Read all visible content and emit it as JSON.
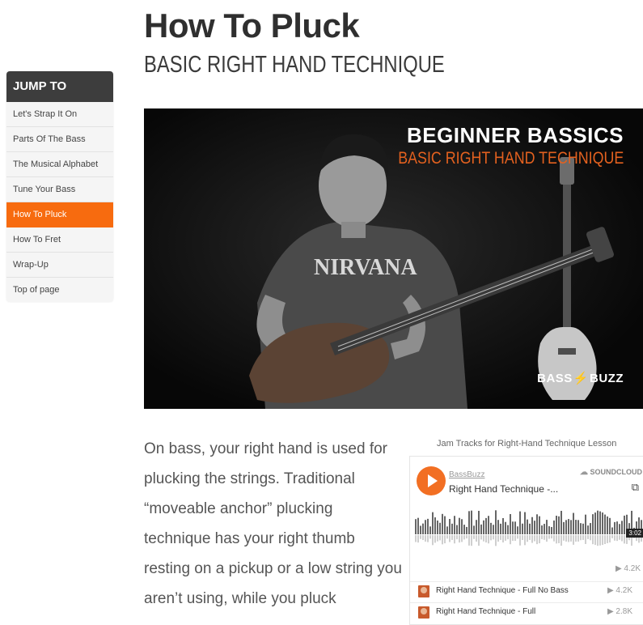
{
  "sidebar": {
    "heading": "JUMP TO",
    "items": [
      {
        "label": "Let's Strap It On"
      },
      {
        "label": "Parts Of The Bass"
      },
      {
        "label": "The Musical Alphabet"
      },
      {
        "label": "Tune Your Bass"
      },
      {
        "label": "How To Pluck",
        "active": true
      },
      {
        "label": "How To Fret"
      },
      {
        "label": "Wrap-Up"
      },
      {
        "label": "Top of page"
      }
    ]
  },
  "page": {
    "title": "How To Pluck",
    "subtitle": "BASIC RIGHT HAND TECHNIQUE"
  },
  "video": {
    "title_line1": "BEGINNER BASSICS",
    "title_line2": "BASIC RIGHT HAND TECHNIQUE",
    "shirt_text": "NIRVANA",
    "logo_left": "BASS",
    "logo_right": "BUZZ"
  },
  "body": {
    "text": "On bass, your right hand is used for plucking the strings. Traditional “moveable anchor” plucking technique has your right thumb resting on a pickup or a low string you aren’t using, while you pluck"
  },
  "jam_tracks": {
    "title": "Jam Tracks for Right-Hand Technique Lesson",
    "player": {
      "user": "BassBuzz",
      "track": "Right Hand Technique -...",
      "brand": "SOUNDCLOUD",
      "duration": "3:02",
      "plays": "4.2K",
      "play_icon": "play-icon",
      "share_icon": "share-icon"
    },
    "tracks": [
      {
        "title": "Right Hand Technique - Full No Bass",
        "plays": "4.2K"
      },
      {
        "title": "Right Hand Technique - Full",
        "plays": "2.8K"
      }
    ]
  },
  "colors": {
    "accent": "#f76b0f",
    "sidebar_header": "#3d3d3d",
    "soundcloud": "#f26f23"
  }
}
